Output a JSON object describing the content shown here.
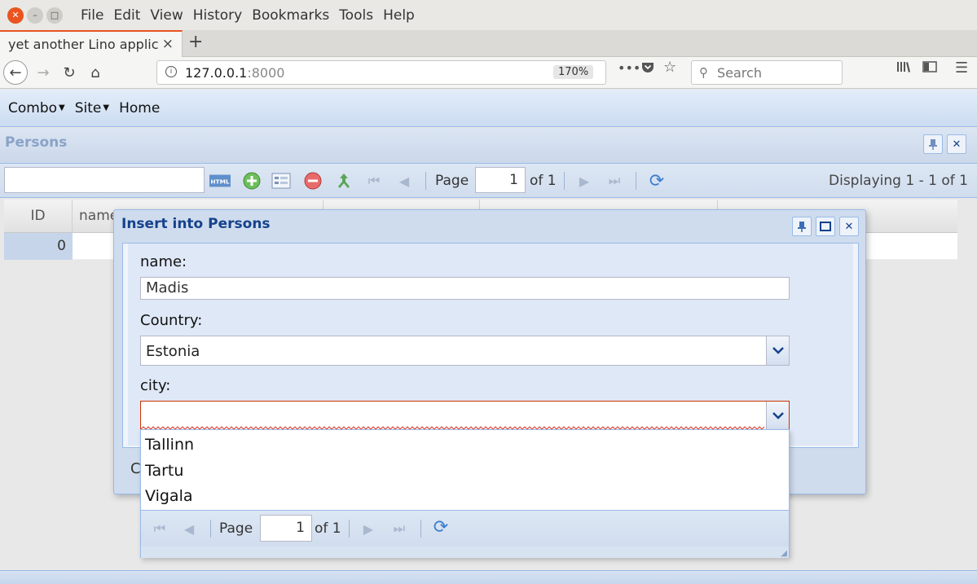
{
  "browser": {
    "window_menu": [
      "File",
      "Edit",
      "View",
      "History",
      "Bookmarks",
      "Tools",
      "Help"
    ],
    "tab": {
      "title": "yet another Lino applic",
      "close": "×"
    },
    "new_tab": "+",
    "url_host": "127.0.0.1",
    "url_port": ":8000",
    "zoom": "170%",
    "page_actions": "•••",
    "search_placeholder": "Search"
  },
  "app": {
    "menu": [
      "Combo",
      "Site",
      "Home"
    ],
    "panel_title": "Persons",
    "grid_toolbar": {
      "page_label": "Page",
      "page_value": "1",
      "of_label": "of 1",
      "displaying": "Displaying 1 - 1 of 1"
    },
    "grid": {
      "columns": [
        "ID",
        "name"
      ],
      "rows": [
        {
          "id": "0"
        }
      ]
    }
  },
  "dialog": {
    "title": "Insert into Persons",
    "fields": {
      "name_label": "name:",
      "name_value": "Madis",
      "country_label": "Country:",
      "country_value": "Estonia",
      "city_label": "city:",
      "city_value": ""
    },
    "footer_partial": "C"
  },
  "city_dropdown": {
    "options": [
      "Tallinn",
      "Tartu",
      "Vigala"
    ],
    "pager": {
      "page_label": "Page",
      "page_value": "1",
      "of_label": "of 1"
    }
  },
  "colors": {
    "accent_orange": "#e95420",
    "ext_blue": "#15428b",
    "invalid_red": "#cc3300"
  }
}
